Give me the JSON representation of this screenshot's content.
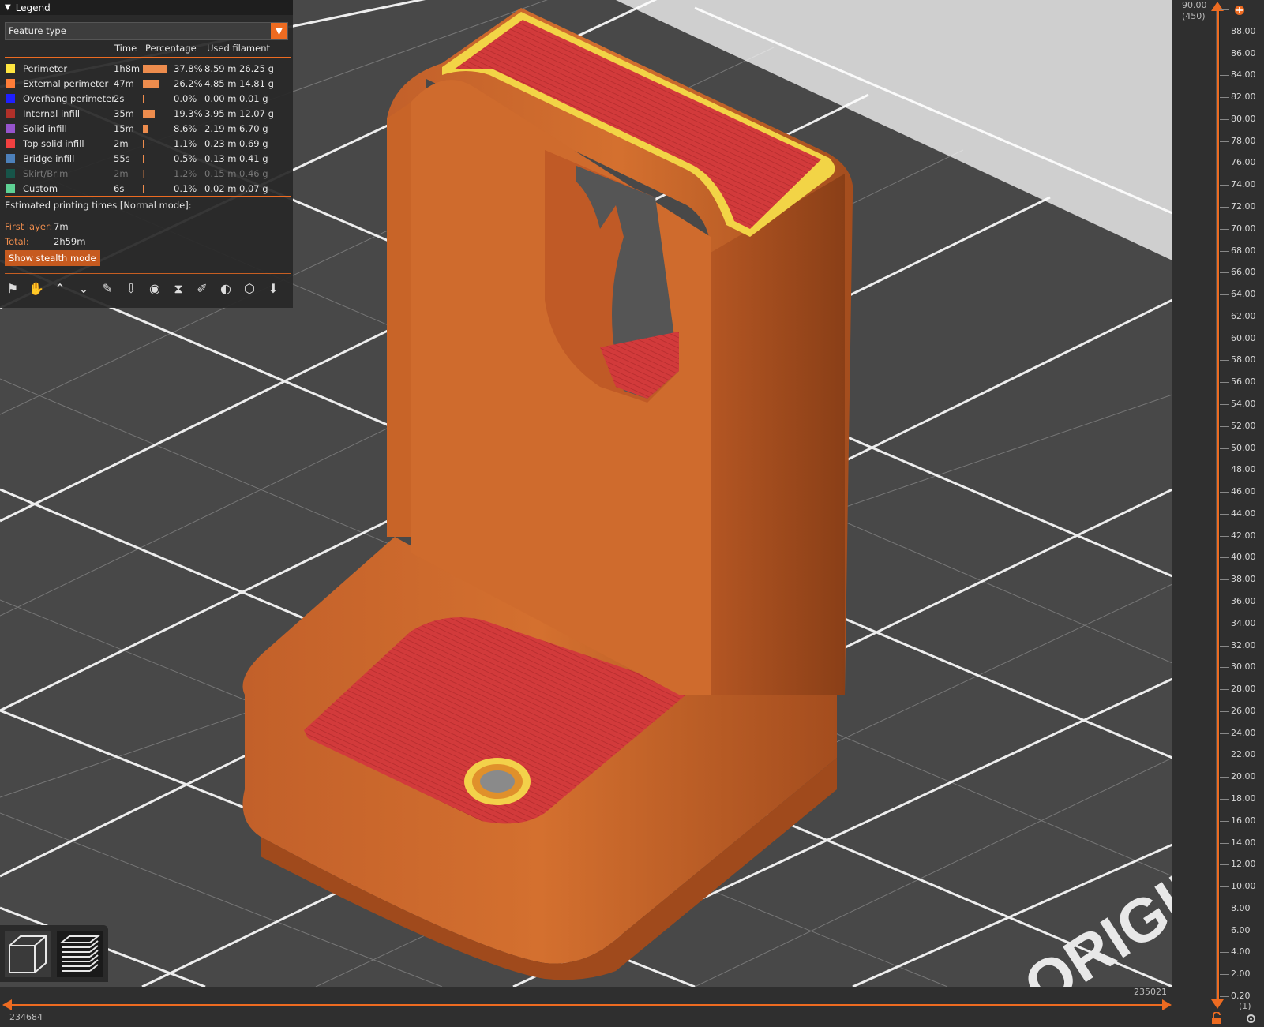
{
  "legend": {
    "title": "Legend",
    "view_type": "Feature type",
    "columns": {
      "time": "Time",
      "percentage": "Percentage",
      "used_filament": "Used filament"
    },
    "items": [
      {
        "name": "Perimeter",
        "time": "1h8m",
        "pct": "37.8%",
        "len": "8.59 m",
        "weight": "26.25 g",
        "color": "#ffe640",
        "share": 0.378,
        "dim": false
      },
      {
        "name": "External perimeter",
        "time": "47m",
        "pct": "26.2%",
        "len": "4.85 m",
        "weight": "14.81 g",
        "color": "#ff7d38",
        "share": 0.262,
        "dim": false
      },
      {
        "name": "Overhang perimeter",
        "time": "2s",
        "pct": "0.0%",
        "len": "0.00 m",
        "weight": "0.01 g",
        "color": "#1f1fff",
        "share": 0.0,
        "dim": false
      },
      {
        "name": "Internal infill",
        "time": "35m",
        "pct": "19.3%",
        "len": "3.95 m",
        "weight": "12.07 g",
        "color": "#b03029",
        "share": 0.193,
        "dim": false
      },
      {
        "name": "Solid infill",
        "time": "15m",
        "pct": "8.6%",
        "len": "2.19 m",
        "weight": "6.70 g",
        "color": "#9654cc",
        "share": 0.086,
        "dim": false
      },
      {
        "name": "Top solid infill",
        "time": "2m",
        "pct": "1.1%",
        "len": "0.23 m",
        "weight": "0.69 g",
        "color": "#f04040",
        "share": 0.011,
        "dim": false
      },
      {
        "name": "Bridge infill",
        "time": "55s",
        "pct": "0.5%",
        "len": "0.13 m",
        "weight": "0.41 g",
        "color": "#4d80ba",
        "share": 0.005,
        "dim": false
      },
      {
        "name": "Skirt/Brim",
        "time": "2m",
        "pct": "1.2%",
        "len": "0.15 m",
        "weight": "0.46 g",
        "color": "#00876e",
        "share": 0.012,
        "dim": true
      },
      {
        "name": "Custom",
        "time": "6s",
        "pct": "0.1%",
        "len": "0.02 m",
        "weight": "0.07 g",
        "color": "#5ed194",
        "share": 0.001,
        "dim": false
      }
    ],
    "estimated_label": "Estimated printing times [Normal mode]:",
    "first_layer_label": "First layer:",
    "first_layer_value": "7m",
    "total_label": "Total:",
    "total_value": "2h59m",
    "stealth_button": "Show stealth mode",
    "toolbar_icons": [
      "travel-icon",
      "wipe-icon",
      "retractions-icon",
      "deretractions-icon",
      "seams-icon",
      "tool-changes-icon",
      "color-changes-icon",
      "pause-prints-icon",
      "custom-gcodes-icon",
      "center-of-gravity-icon",
      "shells-icon",
      "tool-marker-icon"
    ]
  },
  "vslider": {
    "top_value": "90.00",
    "top_layer": "(450)",
    "bottom_layer": "(1)",
    "labels": [
      "90.00",
      "88.00",
      "86.00",
      "84.00",
      "82.00",
      "80.00",
      "78.00",
      "76.00",
      "74.00",
      "72.00",
      "70.00",
      "68.00",
      "66.00",
      "64.00",
      "62.00",
      "60.00",
      "58.00",
      "56.00",
      "54.00",
      "52.00",
      "50.00",
      "48.00",
      "46.00",
      "44.00",
      "42.00",
      "40.00",
      "38.00",
      "36.00",
      "34.00",
      "32.00",
      "30.00",
      "28.00",
      "26.00",
      "24.00",
      "22.00",
      "20.00",
      "18.00",
      "16.00",
      "14.00",
      "12.00",
      "10.00",
      "8.00",
      "6.00",
      "4.00",
      "2.00",
      "0.20"
    ]
  },
  "hslider": {
    "min": "234684",
    "max": "235021"
  },
  "bed_text": "ORIGIN",
  "colors": {
    "accent": "#ed6b21",
    "model": "#c9622a",
    "infill": "#d3393a"
  }
}
